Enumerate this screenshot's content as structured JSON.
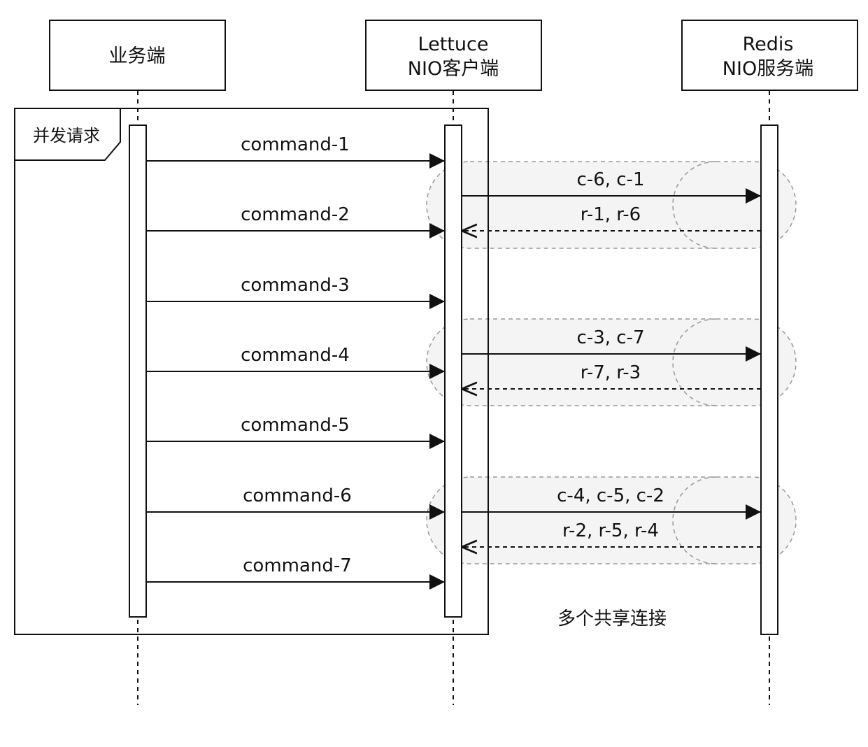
{
  "participants": [
    {
      "id": "business",
      "lines": [
        "业务端"
      ]
    },
    {
      "id": "lettuce",
      "lines": [
        "Lettuce",
        "NIO客户端"
      ]
    },
    {
      "id": "redis",
      "lines": [
        "Redis",
        "NIO服务端"
      ]
    }
  ],
  "frame": {
    "label": "并发请求"
  },
  "commands": [
    "command-1",
    "command-2",
    "command-3",
    "command-4",
    "command-5",
    "command-6",
    "command-7"
  ],
  "connections": [
    {
      "request": "c-6, c-1",
      "response": "r-1, r-6"
    },
    {
      "request": "c-3, c-7",
      "response": "r-7, r-3"
    },
    {
      "request": "c-4, c-5, c-2",
      "response": "r-2, r-5, r-4"
    }
  ],
  "note": "多个共享连接"
}
